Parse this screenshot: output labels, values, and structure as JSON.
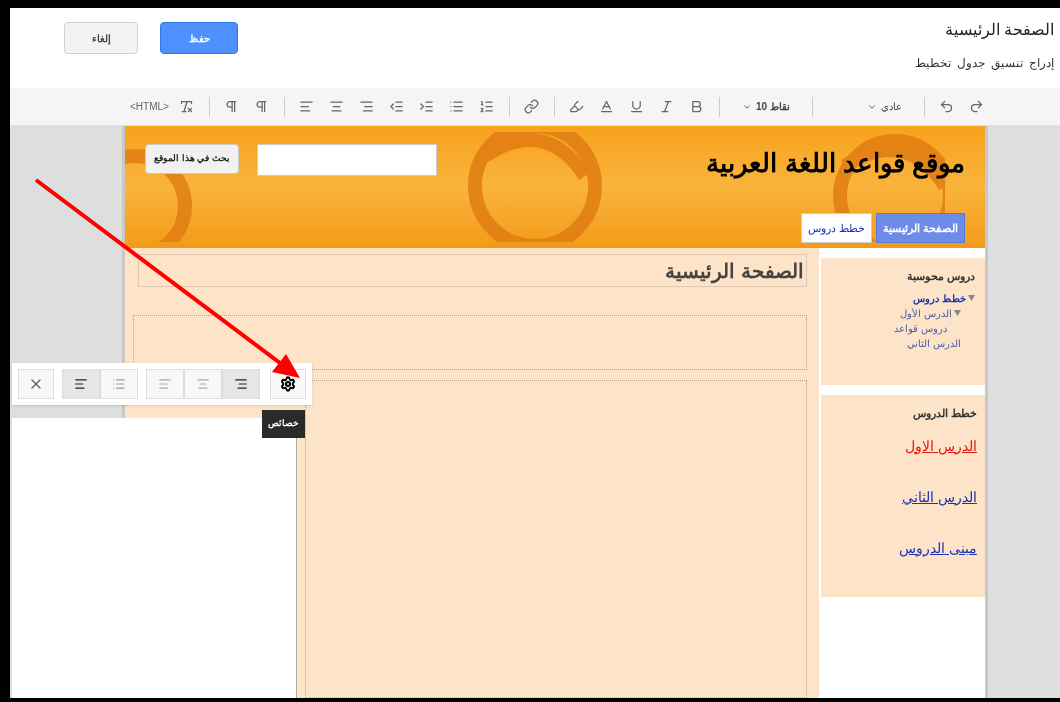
{
  "header": {
    "title": "الصفحة الرئيسية",
    "menu": [
      "إدراج",
      "تنسيق",
      "جدول",
      "تخطيط"
    ],
    "save_button": "حفظ",
    "cancel_button": "إلغاء"
  },
  "toolbar": {
    "html_button": "<HTML>",
    "font_size": "10 نقاط",
    "paragraph_style": "عادي"
  },
  "site": {
    "title": "موقع قواعد اللغة العربية",
    "search_button": "بحث في هذا الموقع",
    "nav_tabs": [
      {
        "label": "الصفحة الرئيسية",
        "selected": true
      },
      {
        "label": "خطط دروس",
        "selected": false
      }
    ]
  },
  "page_heading": "الصفحة الرئيسية",
  "sidebar": {
    "nav_heading": "دروس محوسبة",
    "tree": [
      {
        "label": "خطط دروس",
        "expanded": true,
        "children": [
          {
            "label": "الدرس الأول",
            "expanded": true,
            "children": [
              {
                "label": "دروس قواعد"
              }
            ]
          },
          {
            "label": "الدرس الثاني"
          }
        ]
      }
    ],
    "links_heading": "خطط الدروس",
    "links": [
      {
        "label": "الدرس الاول",
        "color": "#e8160c"
      },
      {
        "label": "الدرس الثاني",
        "color": "#1a33b8"
      },
      {
        "label": "مبنى الدروس",
        "color": "#1a33b8"
      }
    ]
  },
  "image_toolbar": {
    "wrap": [
      {
        "kind": "inline",
        "selected": true
      },
      {
        "kind": "wrap",
        "selected": false
      }
    ],
    "align": [
      {
        "kind": "left",
        "selected": false
      },
      {
        "kind": "center",
        "selected": false
      },
      {
        "kind": "right",
        "selected": true
      }
    ],
    "tooltip": "خصائص"
  }
}
